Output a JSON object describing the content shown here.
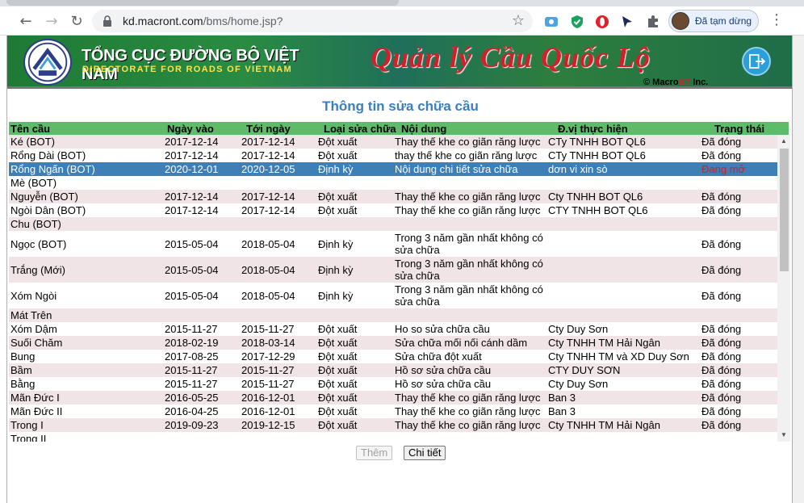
{
  "browser": {
    "url_domain": "kd.macront.com",
    "url_path": "/bms/home.jsp?",
    "profile_label": "Đã tạm dừng"
  },
  "banner": {
    "org_title": "TỔNG CỤC ĐƯỜNG BỘ VIỆT NAM",
    "org_subtitle": "DIRECTORATE FOR ROADS OF VIETNAM",
    "app_title": "Quản lý Cầu Quốc Lộ",
    "copyright_prefix": "© Macro",
    "copyright_brand": "NT",
    "copyright_suffix": " Inc."
  },
  "section_title": "Thông tin sửa chữa cầu",
  "columns": [
    "Tên cầu",
    "Ngày vào",
    "Tới ngày",
    "Loại sửa chữa",
    "Nội dung",
    "Đ.vị thực hiện",
    "Trạng thái"
  ],
  "rows": [
    [
      "Ké (BOT)",
      "2017-12-14",
      "2017-12-14",
      "Đột xuất",
      "Thay thế khe co giãn răng lược",
      "CTy TNHH BOT QL6",
      "Đã đóng"
    ],
    [
      "Rổng Dài (BOT)",
      "2017-12-14",
      "2017-12-14",
      "Đột xuất",
      "thay thế khe co giãn răng lược",
      "CTy TNHH BOT QL6",
      "Đã đóng"
    ],
    [
      "Rổng Ngấn (BOT)",
      "2020-12-01",
      "2020-12-05",
      "Định kỳ",
      "Nội dung chi tiết sửa chữa",
      "dơn vi xin sò",
      "Đang mở"
    ],
    [
      "Mè (BOT)",
      "",
      "",
      "",
      "",
      "",
      ""
    ],
    [
      "Nguyễn (BOT)",
      "2017-12-14",
      "2017-12-14",
      "Đột xuất",
      "Thay thế khe co giãn răng lược",
      "Cty TNHH BOT QL6",
      "Đã đóng"
    ],
    [
      "Ngòi Dân (BOT)",
      "2017-12-14",
      "2017-12-14",
      "Đột xuất",
      "Thay thế khe co giãn răng lược",
      "CTY TNHH BOT QL6",
      "Đã đóng"
    ],
    [
      "Chu (BOT)",
      "",
      "",
      "",
      "",
      "",
      ""
    ],
    [
      "Ngọc (BOT)",
      "2015-05-04",
      "2018-05-04",
      "Định kỳ",
      "Trong 3 năm gần nhất không có sửa chữa",
      "",
      "Đã đóng"
    ],
    [
      "Trắng (Mới)",
      "2015-05-04",
      "2018-05-04",
      "Định kỳ",
      "Trong 3 năm gần nhất không có sửa chữa",
      "",
      "Đã đóng"
    ],
    [
      "Xóm Ngòi",
      "2015-05-04",
      "2018-05-04",
      "Định kỳ",
      "Trong 3 năm gần nhất không có sửa chữa",
      "",
      "Đã đóng"
    ],
    [
      "Mát Trên",
      "",
      "",
      "",
      "",
      "",
      ""
    ],
    [
      "Xóm Dậm",
      "2015-11-27",
      "2015-11-27",
      "Đột xuất",
      "Ho so sửa chữa cầu",
      "Cty Duy Sơn",
      "Đã đóng"
    ],
    [
      "Suối Chăm",
      "2018-02-19",
      "2018-03-14",
      "Đột xuất",
      "Sửa chữa mối nối cánh dầm",
      "Cty TNHH TM Hải Ngân",
      "Đã đóng"
    ],
    [
      "Bung",
      "2017-08-25",
      "2017-12-29",
      "Đột xuất",
      "Sửa chữa đột xuất",
      "Cty TNHH TM và XD Duy Sơn",
      "Đã đóng"
    ],
    [
      "Bầm",
      "2015-11-27",
      "2015-11-27",
      "Đột xuất",
      "Hồ sơ sửa chữa cầu",
      "CTY DUY SƠN",
      "Đã đóng"
    ],
    [
      "Bằng",
      "2015-11-27",
      "2015-11-27",
      "Đột xuất",
      "Hồ sơ sửa chữa cầu",
      "Cty Duy Sơn",
      "Đã đóng"
    ],
    [
      "Mãn Đức I",
      "2016-05-25",
      "2016-12-01",
      "Đột xuất",
      "Thay thế khe co giãn răng lược",
      "Ban 3",
      "Đã đóng"
    ],
    [
      "Mãn Đức II",
      "2016-04-25",
      "2016-12-01",
      "Đột xuất",
      "Thay thế khe co giãn răng lược",
      "Ban 3",
      "Đã đóng"
    ],
    [
      "Trong I",
      "2019-09-23",
      "2019-12-15",
      "Đột xuất",
      "Thay thế khe co giãn răng lược",
      "Cty TNHH TM Hải Ngân",
      "Đã đóng"
    ],
    [
      "Trong II",
      "",
      "",
      "",
      "",
      "",
      ""
    ]
  ],
  "selected_row": 2,
  "buttons": {
    "add": "Thêm",
    "detail": "Chi tiết"
  },
  "colors": {
    "header_green": "#5cbc6a",
    "selected_blue": "#3d7fb6",
    "title_blue": "#3a7fbf",
    "open_status_red": "#d2202a"
  }
}
